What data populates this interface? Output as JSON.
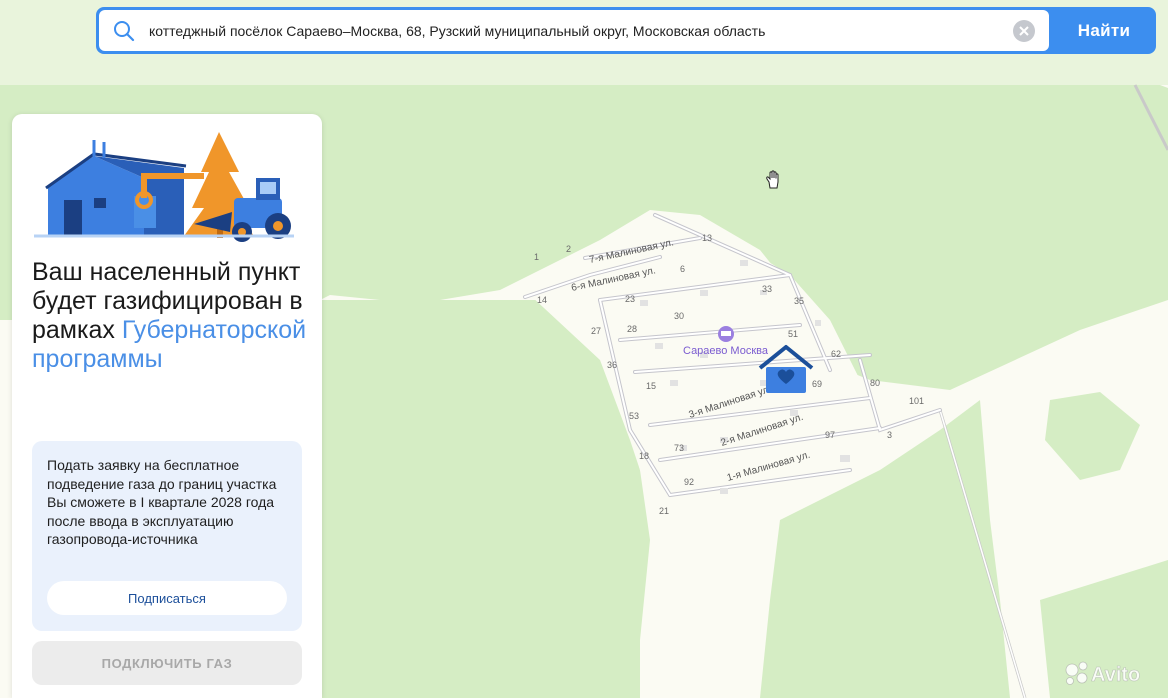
{
  "search": {
    "query": "коттеджный посёлок Сараево–Москва, 68, Рузский муниципальный округ, Московская область",
    "button_label": "Найти"
  },
  "panel": {
    "title_line": "Ваш населенный пункт будет газифицирован в рамках",
    "title_accent": "Губернаторской программы",
    "info_text": "Подать заявку на бесплатное подведение газа до границ участка Вы сможете в I квартале 2028 года после ввода в эксплуатацию газопровода-источника",
    "subscribe_label": "Подписаться",
    "connect_label": "ПОДКЛЮЧИТЬ ГАЗ"
  },
  "map": {
    "poi_name": "Сараево Москва",
    "streets": [
      "7-я Малиновая ул.",
      "6-я Малиновая ул.",
      "3-я Малиновая ул.",
      "2-я Малиновая ул.",
      "1-я Малиновая ул."
    ],
    "house_numbers": [
      "1",
      "2",
      "13",
      "6",
      "14",
      "23",
      "33",
      "35",
      "27",
      "28",
      "30",
      "51",
      "36",
      "62",
      "15",
      "69",
      "80",
      "101",
      "53",
      "73",
      "97",
      "3",
      "18",
      "92",
      "21"
    ],
    "colors": {
      "forest": "#d5edc4",
      "background": "#fbfbf3",
      "accent": "#3c8eef",
      "marker": "#3d7fe0"
    }
  },
  "watermark": "Avito"
}
